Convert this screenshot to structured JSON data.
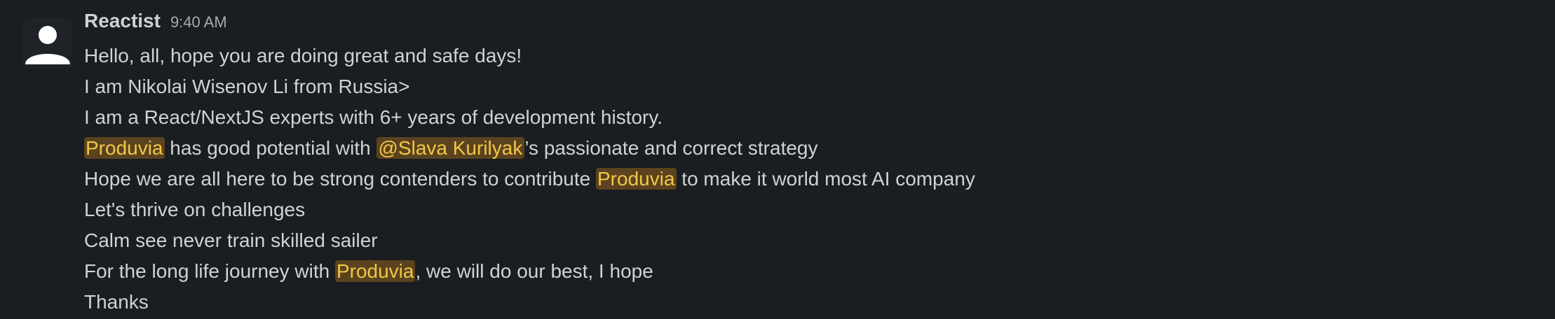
{
  "message": {
    "sender": "Reactist",
    "timestamp": "9:40 AM",
    "avatar_icon": "user-silhouette-icon",
    "highlight_color": "#5b4320",
    "highlight_text_color": "#f2c744",
    "lines": [
      {
        "text": "Hello, all, hope you are doing great and safe days!"
      },
      {
        "text": "I am Nikolai Wisenov Li from Russia>"
      },
      {
        "text": "I am a React/NextJS experts with 6+ years of development history."
      },
      {
        "pre": "",
        "hl1": "Produvia",
        "mid": " has good potential with ",
        "mention": "@Slava Kurilyak",
        "post": "’s passionate and correct strategy"
      },
      {
        "pre": "Hope we are all here to be strong contenders to contribute ",
        "hl1": "Produvia",
        "post": " to make it world most AI company"
      },
      {
        "text": "Let's thrive on challenges"
      },
      {
        "text": "Calm see never train skilled sailer"
      },
      {
        "pre": "For the long life journey with ",
        "hl1": "Produvia",
        "post": ", we will do our best, I hope"
      },
      {
        "text": "Thanks"
      }
    ]
  }
}
